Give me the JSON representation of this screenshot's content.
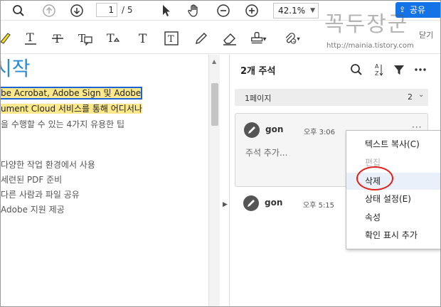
{
  "toolbar": {
    "page_current": "1",
    "page_total": "/ 5",
    "zoom": "42.1%",
    "share_label": "공유",
    "close_label": "닫기"
  },
  "watermark": {
    "title": "꼭두장군",
    "url": "http://mainia.tistory.com"
  },
  "document": {
    "heading": "시작",
    "lines": [
      "be Acrobat, Adobe Sign 및 Adobe",
      "ument Cloud 서비스를 통해 어디서나",
      "을 수행할 수 있는 4가지 유용한 팁",
      "다양한 작업 환경에서 사용",
      "세련된 PDF 준비",
      "다른 사람과 파일 공유",
      "Adobe 지원 제공"
    ]
  },
  "comments_pane": {
    "title": "2개 주석",
    "page_group": {
      "label": "1페이지",
      "count": "2"
    },
    "comments": [
      {
        "author": "gon",
        "time": "오후 3:06",
        "placeholder": "주석 추가..."
      },
      {
        "author": "gon",
        "time": "오후 5:15"
      }
    ]
  },
  "context_menu": {
    "items": [
      {
        "label": "텍스트 복사(C)",
        "enabled": true
      },
      {
        "label": "편집",
        "enabled": false
      },
      {
        "label": "삭제",
        "enabled": true
      },
      {
        "label": "상태 설정(E)",
        "enabled": true
      },
      {
        "label": "속성",
        "enabled": true
      },
      {
        "label": "확인 표시 추가",
        "enabled": true
      }
    ]
  },
  "colors": {
    "accent": "#1473e6",
    "highlight": "#fde98b",
    "annotation_circle": "#e0201a",
    "heading": "#2a8bd0"
  },
  "icons": {
    "toolbar1": [
      "search-icon",
      "page-up-icon",
      "page-down-icon",
      "select-cursor-icon",
      "hand-icon",
      "zoom-out-icon",
      "zoom-in-icon",
      "share-icon"
    ],
    "toolbar2": [
      "highlight-icon",
      "underline-icon",
      "strikethrough-icon",
      "text-comment-icon",
      "replace-text-icon",
      "add-text-icon",
      "text-box-icon",
      "pencil-icon",
      "eraser-icon",
      "stamp-icon",
      "attach-icon"
    ],
    "pane": [
      "search-icon",
      "sort-icon",
      "filter-icon",
      "more-icon"
    ]
  }
}
